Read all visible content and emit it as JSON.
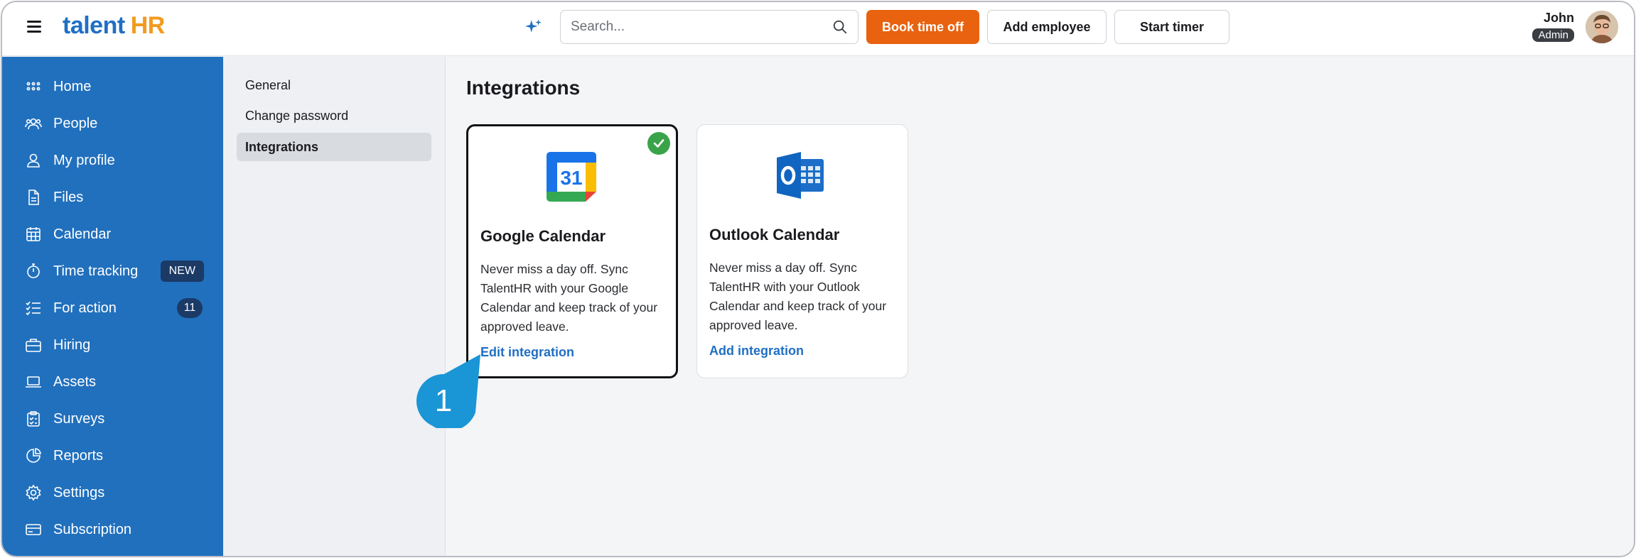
{
  "app": {
    "logo_main": "talent",
    "logo_accent": "HR"
  },
  "header": {
    "search_placeholder": "Search...",
    "book_time_off": "Book time off",
    "add_employee": "Add employee",
    "start_timer": "Start timer",
    "user_name": "John",
    "user_role": "Admin"
  },
  "sidebar": {
    "items": [
      {
        "label": "Home",
        "icon": "grid-icon"
      },
      {
        "label": "People",
        "icon": "people-icon"
      },
      {
        "label": "My profile",
        "icon": "user-icon"
      },
      {
        "label": "Files",
        "icon": "file-icon"
      },
      {
        "label": "Calendar",
        "icon": "calendar-icon"
      },
      {
        "label": "Time tracking",
        "icon": "stopwatch-icon",
        "badge": "NEW"
      },
      {
        "label": "For action",
        "icon": "checklist-icon",
        "count": "11"
      },
      {
        "label": "Hiring",
        "icon": "briefcase-icon"
      },
      {
        "label": "Assets",
        "icon": "laptop-icon"
      },
      {
        "label": "Surveys",
        "icon": "clipboard-icon"
      },
      {
        "label": "Reports",
        "icon": "pie-chart-icon"
      },
      {
        "label": "Settings",
        "icon": "gear-icon"
      },
      {
        "label": "Subscription",
        "icon": "credit-card-icon"
      }
    ]
  },
  "settings_nav": {
    "items": [
      "General",
      "Change password",
      "Integrations"
    ],
    "active": "Integrations"
  },
  "main": {
    "title": "Integrations",
    "cards": [
      {
        "title": "Google Calendar",
        "description": "Never miss a day off. Sync TalentHR with your Google Calendar and keep track of your approved leave.",
        "link": "Edit integration",
        "connected": true,
        "logo_text": "31"
      },
      {
        "title": "Outlook Calendar",
        "description": "Never miss a day off. Sync TalentHR with your Outlook Calendar and keep track of your approved leave.",
        "link": "Add integration",
        "connected": false
      }
    ]
  },
  "callout": {
    "number": "1"
  },
  "colors": {
    "sidebar": "#2170bd",
    "accent_orange": "#e8620f",
    "link_blue": "#1f6fc4",
    "success_green": "#3aa34a",
    "callout_blue": "#1a95d6"
  }
}
